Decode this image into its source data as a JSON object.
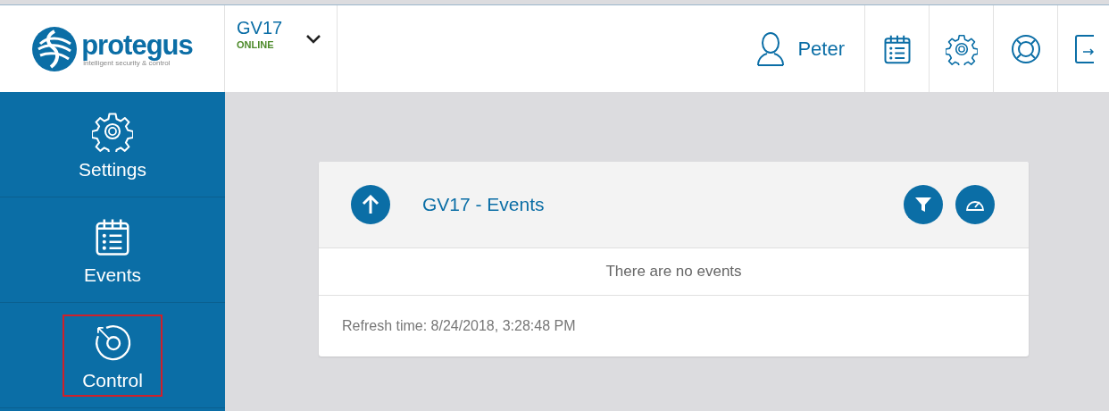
{
  "logo": {
    "name": "protegus",
    "tagline": "intelligent security & control"
  },
  "device": {
    "name": "GV17",
    "status": "ONLINE"
  },
  "user": {
    "name": "Peter"
  },
  "sidebar": {
    "items": [
      {
        "label": "Settings",
        "kind": "settings",
        "selected": false,
        "highlighted": false
      },
      {
        "label": "Events",
        "kind": "events",
        "selected": false,
        "highlighted": false
      },
      {
        "label": "Control",
        "kind": "control",
        "selected": false,
        "highlighted": true
      }
    ]
  },
  "panel": {
    "title": "GV17 - Events",
    "empty_message": "There are no events",
    "refresh": "Refresh time: 8/24/2018, 3:28:48 PM"
  }
}
